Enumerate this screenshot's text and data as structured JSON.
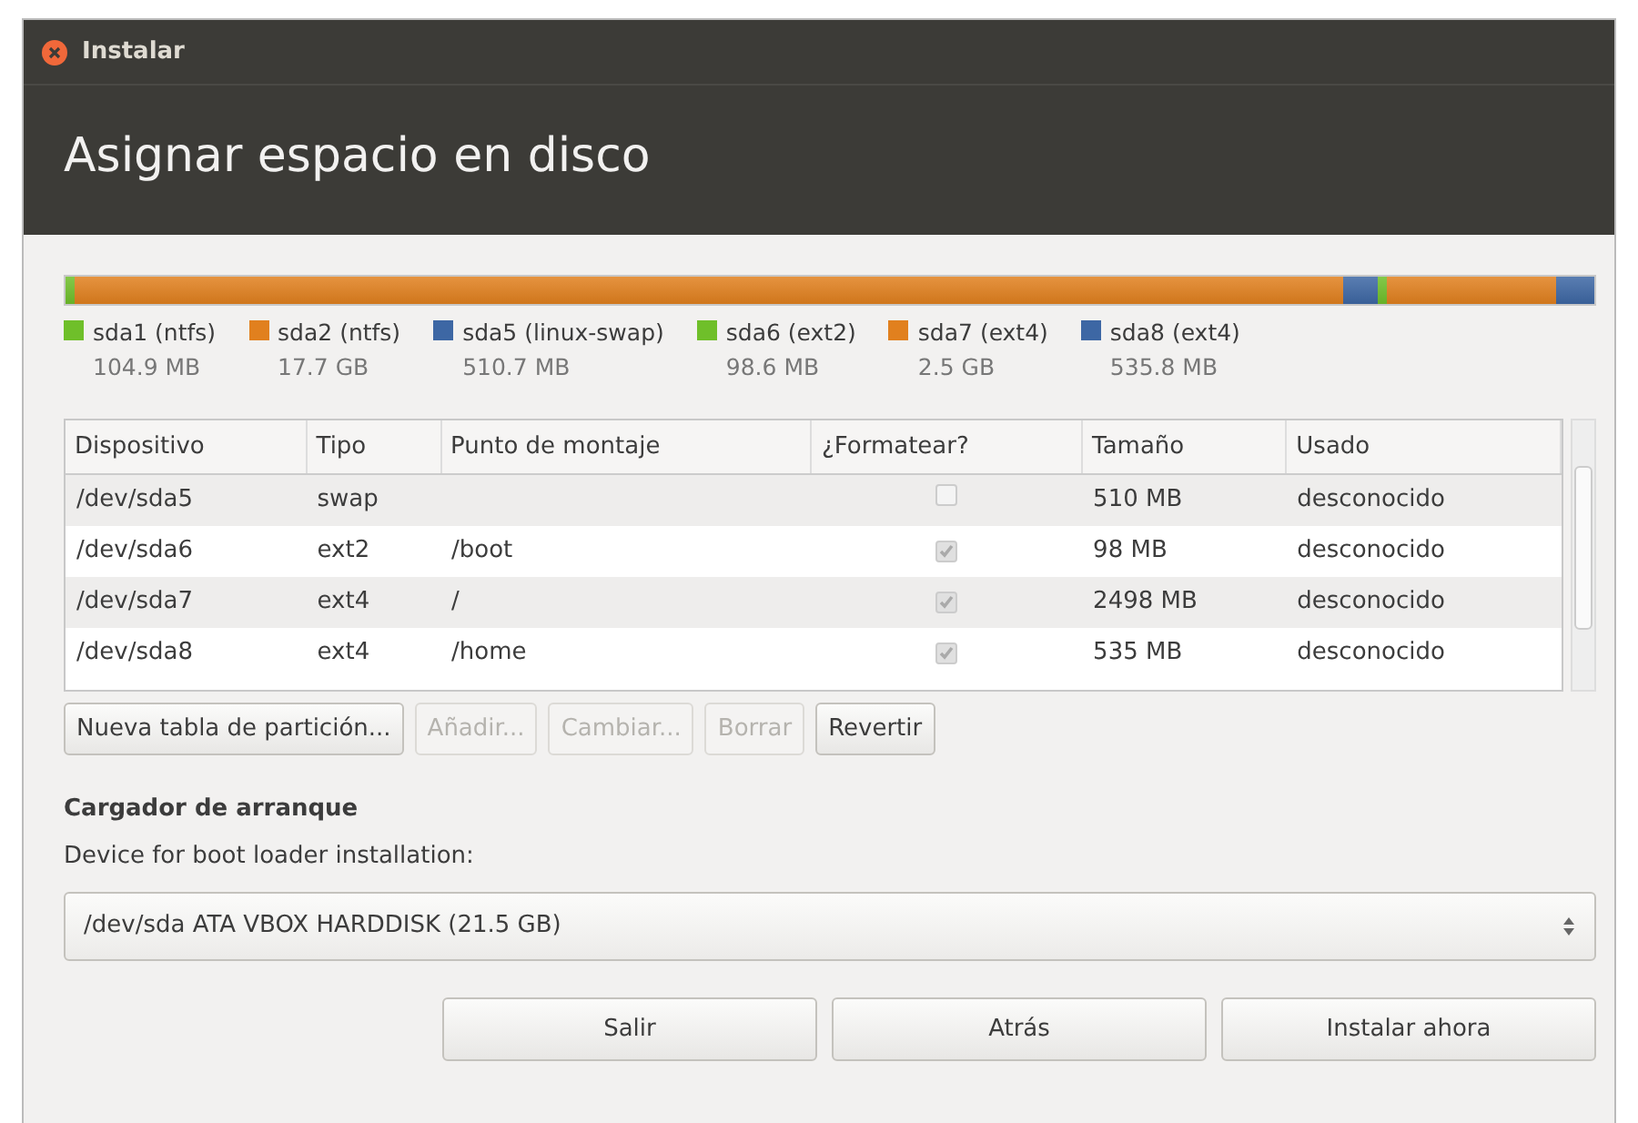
{
  "window": {
    "title": "Instalar"
  },
  "header": {
    "title": "Asignar espacio en disco"
  },
  "legend": [
    {
      "name": "sda1 (ntfs)",
      "size": "104.9 MB",
      "color": "#6fbf2a"
    },
    {
      "name": "sda2 (ntfs)",
      "size": "17.7 GB",
      "color": "#e1801e"
    },
    {
      "name": "sda5 (linux-swap)",
      "size": "510.7 MB",
      "color": "#3d67a4"
    },
    {
      "name": "sda6 (ext2)",
      "size": "98.6 MB",
      "color": "#6fbf2a"
    },
    {
      "name": "sda7 (ext4)",
      "size": "2.5 GB",
      "color": "#e1801e"
    },
    {
      "name": "sda8 (ext4)",
      "size": "535.8 MB",
      "color": "#3d67a4"
    }
  ],
  "table": {
    "columns": [
      "Dispositivo",
      "Tipo",
      "Punto de montaje",
      "¿Formatear?",
      "Tamaño",
      "Usado"
    ],
    "rows": [
      {
        "device": "/dev/sda5",
        "type": "swap",
        "mount": "",
        "format": false,
        "size": "510 MB",
        "used": "desconocido"
      },
      {
        "device": "/dev/sda6",
        "type": "ext2",
        "mount": "/boot",
        "format": true,
        "size": "98 MB",
        "used": "desconocido"
      },
      {
        "device": "/dev/sda7",
        "type": "ext4",
        "mount": "/",
        "format": true,
        "size": "2498 MB",
        "used": "desconocido"
      },
      {
        "device": "/dev/sda8",
        "type": "ext4",
        "mount": "/home",
        "format": true,
        "size": "535 MB",
        "used": "desconocido"
      }
    ]
  },
  "partition_buttons": [
    {
      "label": "Nueva tabla de partición...",
      "disabled": false
    },
    {
      "label": "Añadir...",
      "disabled": true
    },
    {
      "label": "Cambiar...",
      "disabled": true
    },
    {
      "label": "Borrar",
      "disabled": true
    },
    {
      "label": "Revertir",
      "disabled": false
    }
  ],
  "boot_loader": {
    "heading": "Cargador de arranque",
    "label": "Device for boot loader installation:",
    "value": "/dev/sda ATA VBOX HARDDISK (21.5 GB)"
  },
  "buttons": [
    "Salir",
    "Atrás",
    "Instalar ahora"
  ]
}
